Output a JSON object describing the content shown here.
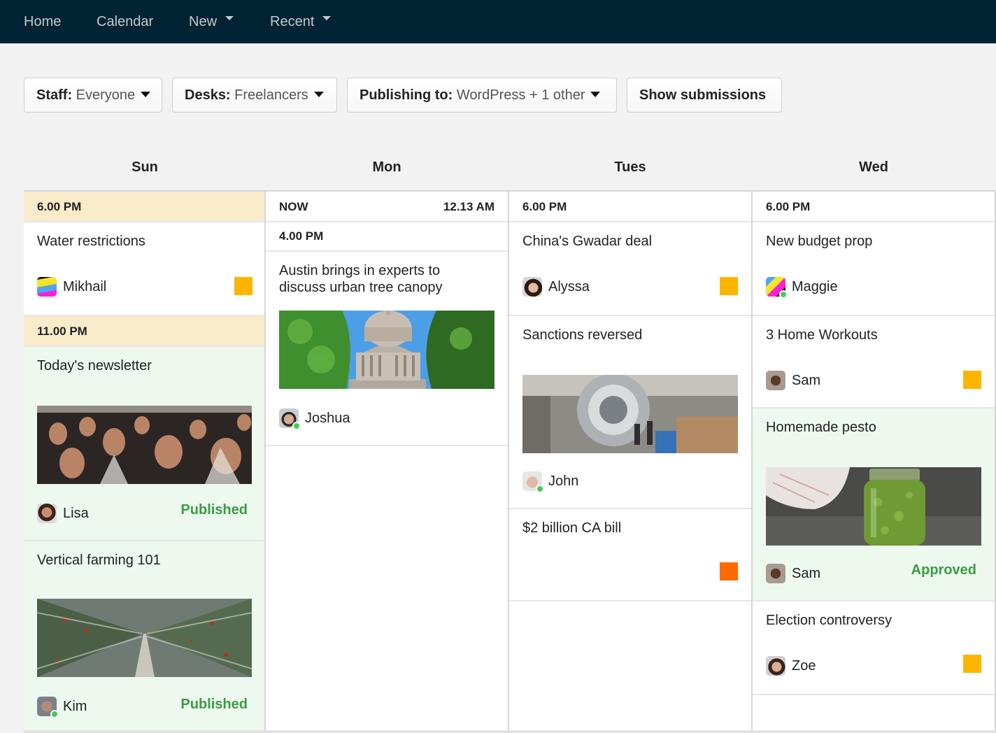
{
  "nav": {
    "items": [
      {
        "label": "Home",
        "dropdown": false
      },
      {
        "label": "Calendar",
        "dropdown": false
      },
      {
        "label": "New",
        "dropdown": true
      },
      {
        "label": "Recent",
        "dropdown": true
      }
    ]
  },
  "filters": {
    "staff": {
      "label": "Staff:",
      "value": "Everyone"
    },
    "desks": {
      "label": "Desks:",
      "value": "Freelancers"
    },
    "publishing": {
      "label": "Publishing to:",
      "value": "WordPress + 1 other"
    },
    "show_submissions": "Show submissions"
  },
  "colors": {
    "nav_bg": "#022334",
    "time_highlight": "#faebcb",
    "done_bg": "#edf8ee",
    "status_green": "#3a9b45",
    "badge_yellow": "#ffb400",
    "badge_orange": "#ff6a00",
    "online_dot": "#44cc55"
  },
  "days": [
    {
      "name": "Sun",
      "times": [
        {
          "label": "6.00 PM",
          "highlight": true
        },
        {
          "label": "11.00 PM",
          "highlight": true
        }
      ],
      "items": [
        {
          "title": "Water restrictions",
          "author": "Mikhail",
          "avatar": "striped-avatar",
          "online": false,
          "badge": "yellow",
          "status": null,
          "image": null
        },
        {
          "title": "Today's newsletter",
          "author": "Lisa",
          "avatar": "photo-avatar",
          "online": false,
          "badge": null,
          "status": "Published",
          "image": "concert-crowd-image"
        },
        {
          "title": "Vertical farming 101",
          "author": "Kim",
          "avatar": "photo-avatar",
          "online": true,
          "badge": null,
          "status": "Published",
          "image": "greenhouse-image"
        }
      ]
    },
    {
      "name": "Mon",
      "times": [
        {
          "label": "NOW",
          "right": "12.13 AM"
        },
        {
          "label": "4.00 PM"
        }
      ],
      "items": [
        {
          "title": "Austin brings in experts to discuss urban tree canopy",
          "author": "Joshua",
          "avatar": "photo-avatar",
          "online": true,
          "badge": null,
          "status": null,
          "image": "capitol-building-image"
        }
      ]
    },
    {
      "name": "Tues",
      "times": [
        {
          "label": "6.00 PM"
        }
      ],
      "items": [
        {
          "title": "China's Gwadar deal",
          "author": "Alyssa",
          "avatar": "photo-avatar",
          "online": false,
          "badge": "yellow",
          "status": null,
          "image": null
        },
        {
          "title": "Sanctions reversed",
          "author": "John",
          "avatar": "photo-avatar",
          "online": true,
          "badge": null,
          "status": null,
          "image": "factory-image"
        },
        {
          "title": "$2 billion CA bill",
          "author": null,
          "badge": "orange",
          "status": null,
          "image": null
        }
      ]
    },
    {
      "name": "Wed",
      "times": [
        {
          "label": "6.00 PM"
        }
      ],
      "items": [
        {
          "title": "New budget prop",
          "author": "Maggie",
          "avatar": "striped-avatar",
          "online": true,
          "badge": null,
          "status": null,
          "image": null
        },
        {
          "title": "3 Home Workouts",
          "author": "Sam",
          "avatar": "photo-avatar",
          "online": false,
          "badge": "yellow",
          "status": null,
          "image": null
        },
        {
          "title": "Homemade pesto",
          "author": "Sam",
          "avatar": "photo-avatar",
          "online": false,
          "badge": null,
          "status": "Approved",
          "image": "pesto-jar-image"
        },
        {
          "title": "Election controversy",
          "author": "Zoe",
          "avatar": "photo-avatar",
          "online": false,
          "badge": "yellow",
          "status": null,
          "image": null
        }
      ]
    }
  ]
}
